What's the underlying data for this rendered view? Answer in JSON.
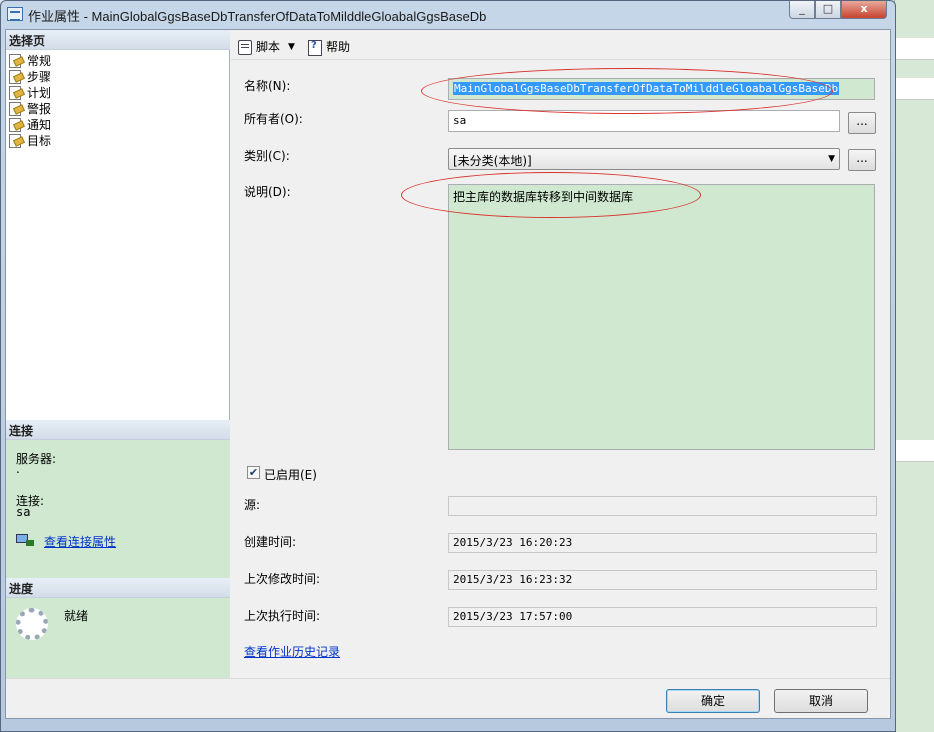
{
  "window": {
    "title": "作业属性 - MainGlobalGgsBaseDbTransferOfDataToMilddleGloabalGgsBaseDb",
    "close_symbol": "x",
    "min_symbol": "_",
    "max_symbol": "□"
  },
  "left": {
    "select_page_header": "选择页",
    "nav_items": [
      "常规",
      "步骤",
      "计划",
      "警报",
      "通知",
      "目标"
    ],
    "connection": {
      "header": "连接",
      "server_label": "服务器:",
      "server_value": ".",
      "connection_label": "连接:",
      "connection_value": "sa",
      "view_properties_link": "查看连接属性"
    },
    "progress": {
      "header": "进度",
      "status": "就绪"
    }
  },
  "toolbar": {
    "script_label": "脚本",
    "help_label": "帮助"
  },
  "form": {
    "name_label": "名称(N):",
    "name_value": "MainGlobalGgsBaseDbTransferOfDataToMilddleGloabalGgsBaseDb",
    "owner_label": "所有者(O):",
    "owner_value": "sa",
    "category_label": "类别(C):",
    "category_value": "[未分类(本地)]",
    "description_label": "说明(D):",
    "description_value": "把主库的数据库转移到中间数据库",
    "enabled_label": "已启用(E)",
    "enabled_checked": true,
    "source_label": "源:",
    "source_value": "",
    "created_label": "创建时间:",
    "created_value": "2015/3/23 16:20:23",
    "modified_label": "上次修改时间:",
    "modified_value": "2015/3/23 16:23:32",
    "last_run_label": "上次执行时间:",
    "last_run_value": "2015/3/23 17:57:00",
    "history_link": "查看作业历史记录",
    "browse_label": "..."
  },
  "footer": {
    "ok_label": "确定",
    "cancel_label": "取消"
  },
  "colors": {
    "highlight_green": "#cfe8cf",
    "annotation_red": "#d9322a",
    "selection_blue": "#3399ff"
  }
}
